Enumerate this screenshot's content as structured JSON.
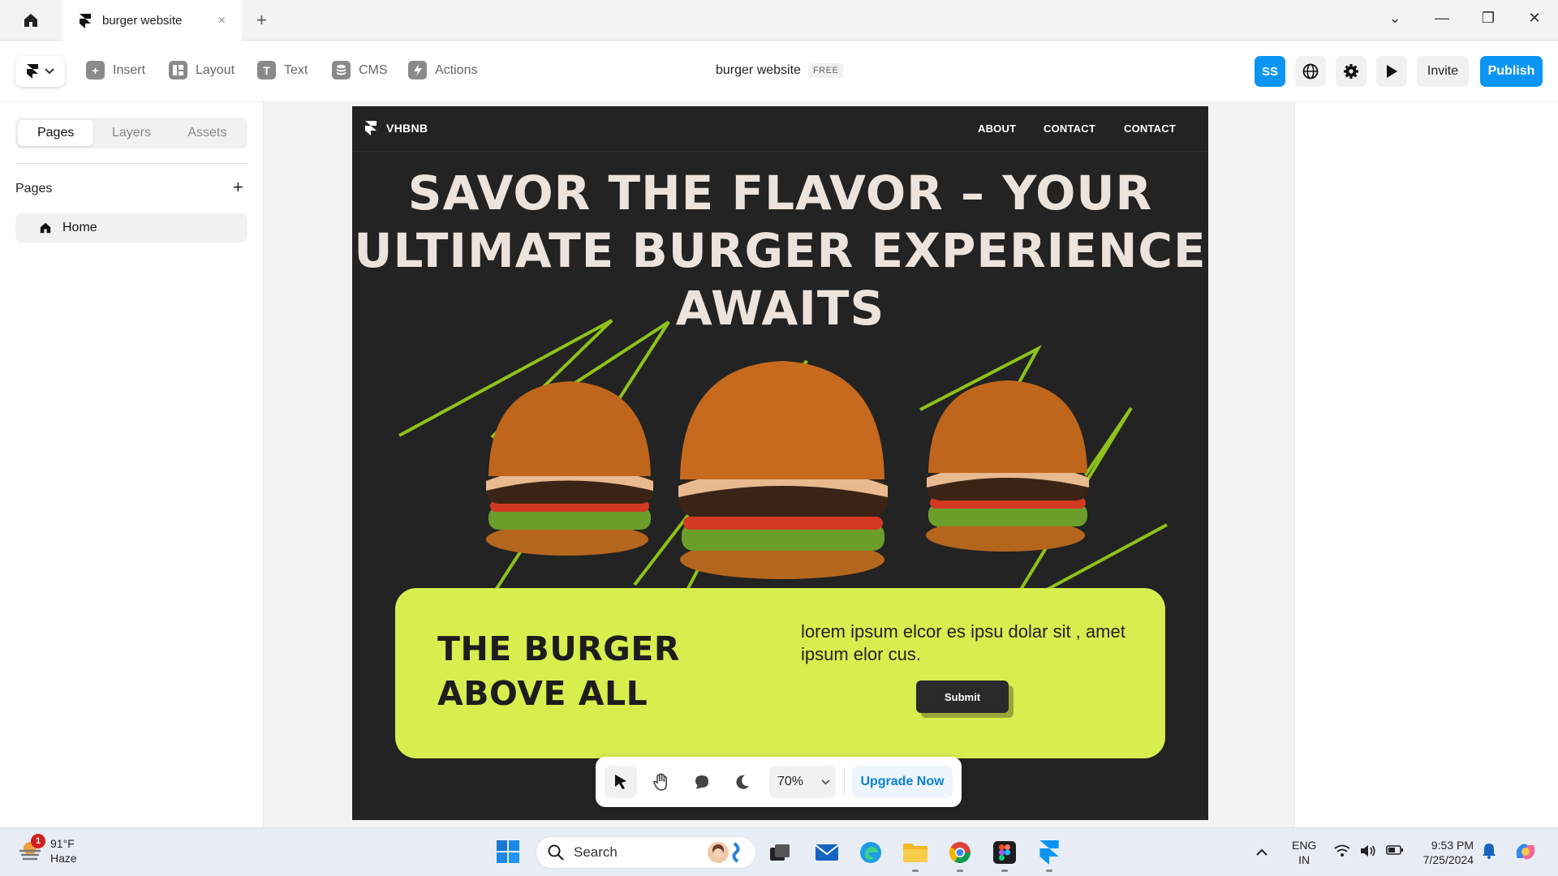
{
  "tabs": {
    "active_title": "burger website",
    "close_glyph": "×",
    "new_glyph": "+"
  },
  "window_controls": {
    "dropdown": "⌄",
    "minimize": "—",
    "restore": "❐",
    "close": "✕"
  },
  "toolbar": {
    "insert": "Insert",
    "layout": "Layout",
    "text": "Text",
    "cms": "CMS",
    "actions": "Actions",
    "project_name": "burger website",
    "plan_badge": "FREE",
    "avatar_initials": "SS",
    "invite": "Invite",
    "publish": "Publish",
    "accent": "#0a95f5"
  },
  "left_panel": {
    "tabs": [
      "Pages",
      "Layers",
      "Assets"
    ],
    "active_tab": "Pages",
    "section_title": "Pages",
    "add_glyph": "+",
    "pages": [
      {
        "label": "Home"
      }
    ]
  },
  "site": {
    "brand": "VHBNB",
    "nav": [
      "ABOUT",
      "CONTACT",
      "CONTACT"
    ],
    "hero_lines": [
      "SAVOR THE FLAVOR – YOUR",
      "ULTIMATE BURGER EXPERIENCE",
      "AWAITS"
    ],
    "card_title_lines": [
      "THE BURGER",
      "ABOVE ALL"
    ],
    "card_text": "lorem ipsum elcor es ipsu dolar sit , amet ipsum elor cus.",
    "submit": "Submit",
    "bg_color": "#232323",
    "accent_color": "#d7ee4f",
    "hero_text_color": "#ece4dc"
  },
  "canvas_toolbar": {
    "zoom": "70%",
    "upgrade": "Upgrade Now"
  },
  "taskbar": {
    "weather_temp": "91°F",
    "weather_desc": "Haze",
    "weather_badge": "1",
    "search_placeholder": "Search",
    "lang_top": "ENG",
    "lang_bottom": "IN",
    "time": "9:53 PM",
    "date": "7/25/2024"
  }
}
